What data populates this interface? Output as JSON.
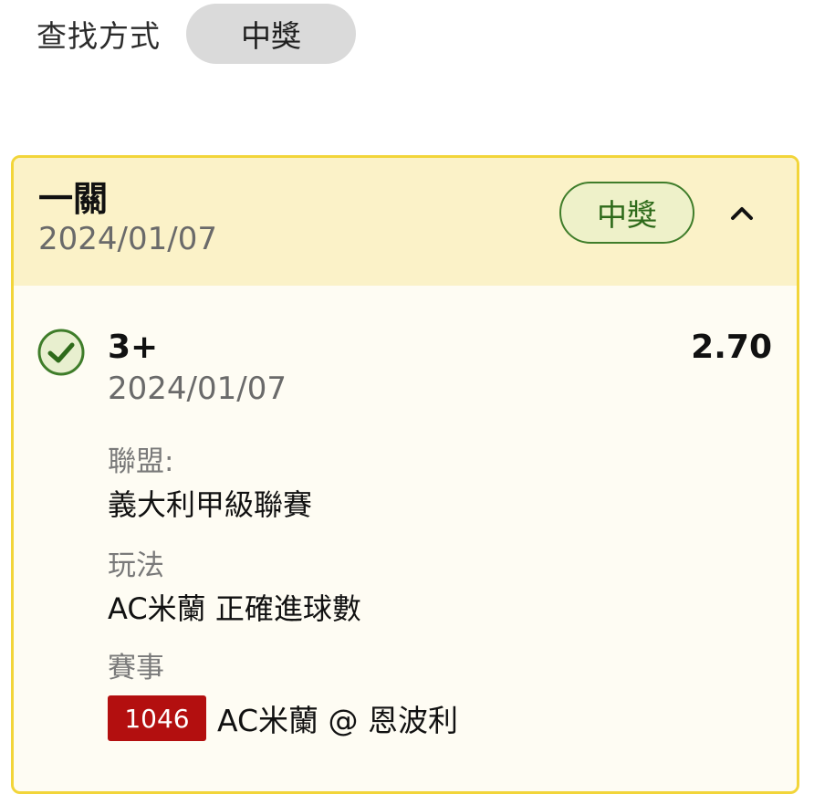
{
  "filter": {
    "label": "查找方式",
    "selected": "中獎"
  },
  "bet": {
    "type": "一關",
    "date": "2024/01/07",
    "result_badge": "中獎",
    "toggle_icon": "chevron-up-icon",
    "selection": {
      "status_icon": "check-circle-icon",
      "name": "3+",
      "odds": "2.70",
      "date": "2024/01/07",
      "league_label": "聯盟:",
      "league_value": "義大利甲級聯賽",
      "play_label": "玩法",
      "play_value": "AC米蘭 正確進球數",
      "match_label": "賽事",
      "match_number": "1046",
      "match_name": "AC米蘭 @ 恩波利"
    }
  },
  "colors": {
    "card_border": "#f2d53a",
    "header_bg": "#fbf2c8",
    "win_green": "#3f7d2a",
    "match_badge_red": "#b30f0f"
  }
}
